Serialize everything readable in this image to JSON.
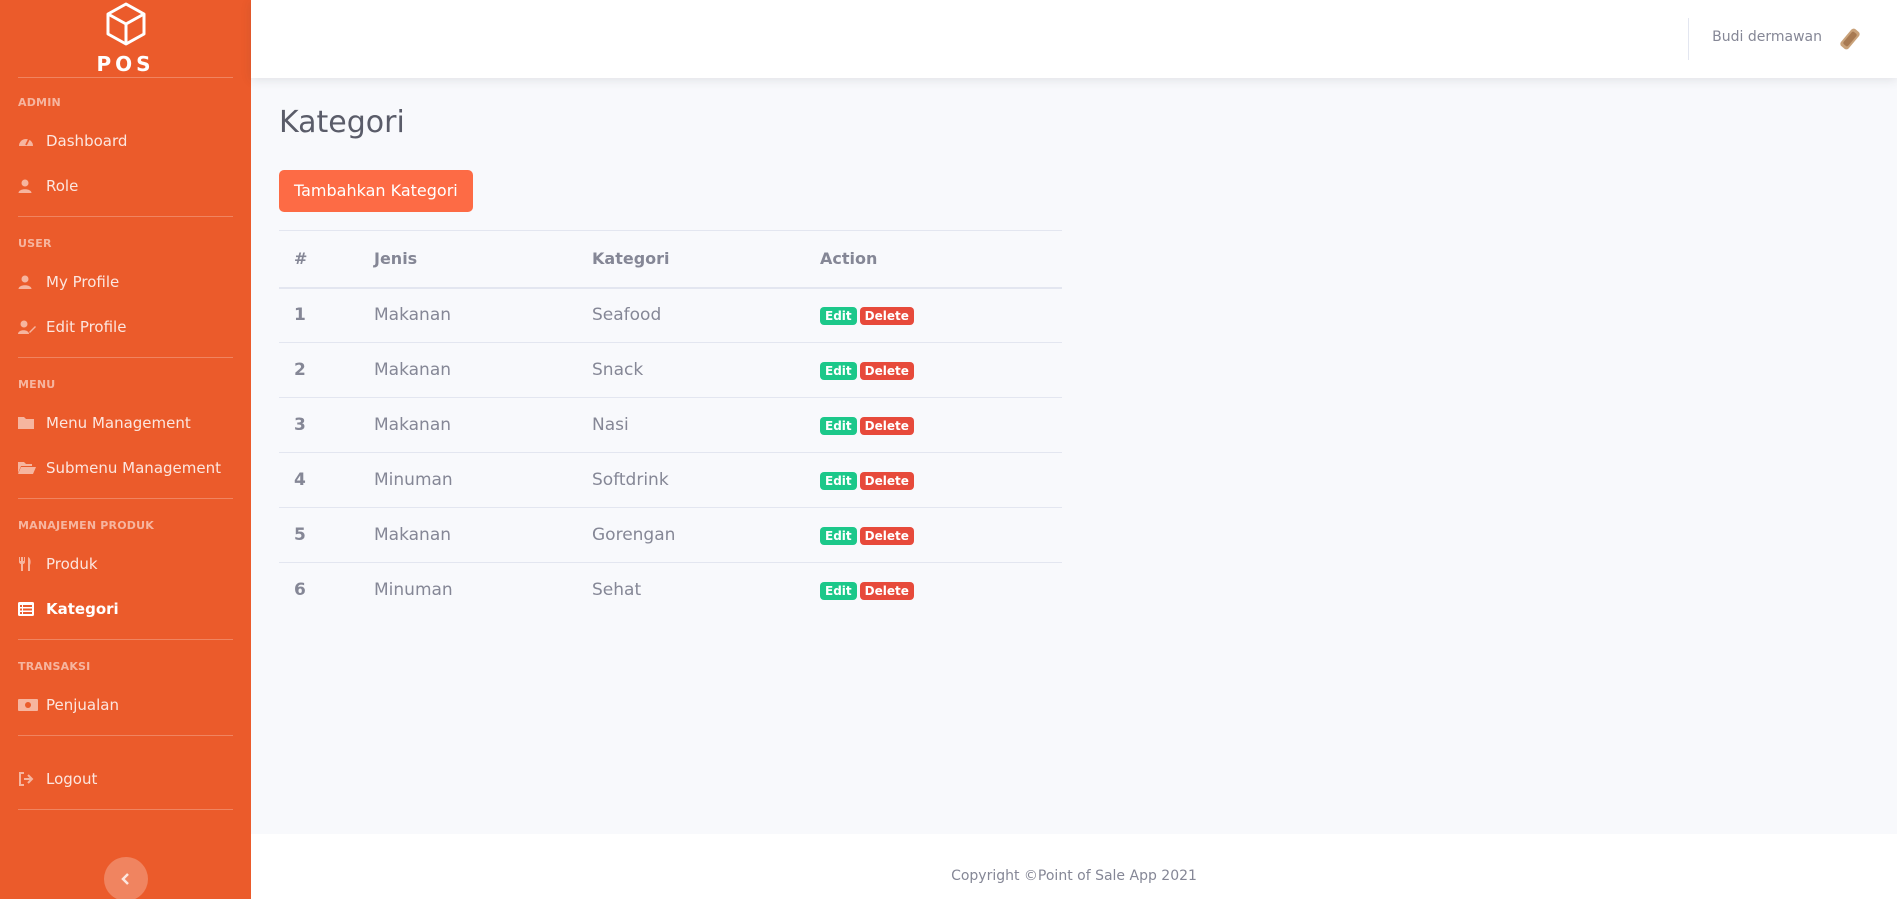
{
  "brand": {
    "logo_text": "POS",
    "icon": "cube-icon"
  },
  "sidebar": {
    "sections": [
      {
        "heading": "Admin",
        "items": [
          {
            "label": "Dashboard",
            "icon": "tachometer-icon"
          },
          {
            "label": "Role",
            "icon": "user-icon"
          }
        ]
      },
      {
        "heading": "User",
        "items": [
          {
            "label": "My Profile",
            "icon": "user-icon"
          },
          {
            "label": "Edit Profile",
            "icon": "user-edit-icon"
          }
        ]
      },
      {
        "heading": "Menu",
        "items": [
          {
            "label": "Menu Management",
            "icon": "folder-icon"
          },
          {
            "label": "Submenu Management",
            "icon": "folder-open-icon"
          }
        ]
      },
      {
        "heading": "Manajemen Produk",
        "items": [
          {
            "label": "Produk",
            "icon": "utensils-icon"
          },
          {
            "label": "Kategori",
            "icon": "list-icon",
            "active": true
          }
        ]
      },
      {
        "heading": "Transaksi",
        "items": [
          {
            "label": "Penjualan",
            "icon": "money-icon"
          }
        ]
      }
    ],
    "logout_label": "Logout",
    "accent_color": "#eb5b2b"
  },
  "topbar": {
    "user_name": "Budi dermawan"
  },
  "page": {
    "title": "Kategori",
    "add_button_label": "Tambahkan Kategori"
  },
  "table": {
    "headers": [
      "#",
      "Jenis",
      "Kategori",
      "Action"
    ],
    "edit_label": "Edit",
    "delete_label": "Delete",
    "rows": [
      {
        "no": "1",
        "jenis": "Makanan",
        "kategori": "Seafood"
      },
      {
        "no": "2",
        "jenis": "Makanan",
        "kategori": "Snack"
      },
      {
        "no": "3",
        "jenis": "Makanan",
        "kategori": "Nasi"
      },
      {
        "no": "4",
        "jenis": "Minuman",
        "kategori": "Softdrink"
      },
      {
        "no": "5",
        "jenis": "Makanan",
        "kategori": "Gorengan"
      },
      {
        "no": "6",
        "jenis": "Minuman",
        "kategori": "Sehat"
      }
    ]
  },
  "footer": {
    "copyright": "Copyright ©Point of Sale App 2021"
  },
  "colors": {
    "primary_button": "#fd6b45",
    "edit_badge": "#1cc88a",
    "delete_badge": "#e74a3b"
  }
}
